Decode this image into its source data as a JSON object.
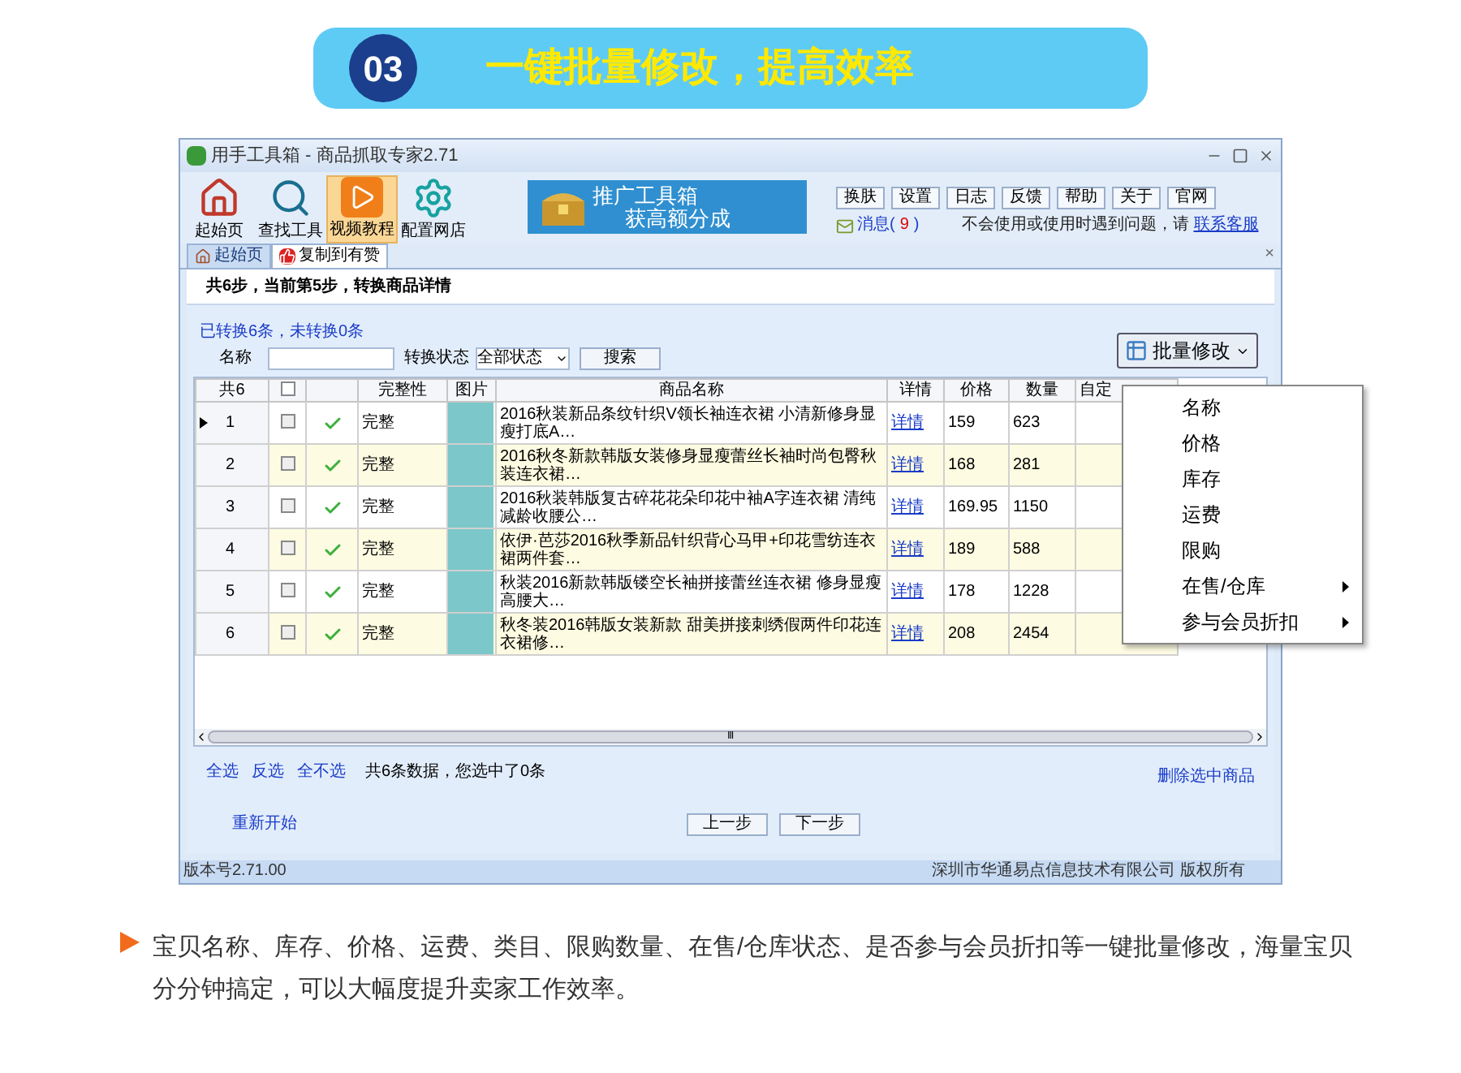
{
  "header": {
    "number": "03",
    "title": "一键批量修改，提高效率"
  },
  "window": {
    "title": "用手工具箱 - 商品抓取专家2.71",
    "toolbar": [
      {
        "label": "起始页",
        "kind": "home",
        "selected": false
      },
      {
        "label": "查找工具",
        "kind": "search",
        "selected": false
      },
      {
        "label": "视频教程",
        "kind": "video",
        "selected": true
      },
      {
        "label": "配置网店",
        "kind": "settings",
        "selected": false
      }
    ],
    "banner": {
      "line1": "推广工具箱",
      "line2": "获高额分成"
    },
    "buttons": [
      "换肤",
      "设置",
      "日志",
      "反馈",
      "帮助",
      "关于",
      "官网"
    ],
    "message": {
      "label": "消息(",
      "count": "9",
      "close": ")"
    },
    "help": {
      "text": "不会使用或使用时遇到问题，请",
      "link": "联系客服"
    },
    "tabs": [
      {
        "label": "起始页",
        "kind": "home",
        "selected": false
      },
      {
        "label": "复制到有赞",
        "kind": "thumb",
        "selected": true
      }
    ],
    "close_tab": "×",
    "step": "共6步，当前第5步，转换商品详情",
    "converted": "已转换6条，未转换0条",
    "filter": {
      "name_label": "名称",
      "status_label": "转换状态",
      "status_value": "全部状态",
      "search_button": "搜索"
    },
    "batch_button": "批量修改",
    "table": {
      "header_checked": false,
      "columns": [
        "共6",
        "",
        "",
        "完整性",
        "图片",
        "商品名称",
        "详情",
        "价格",
        "数量",
        "自定"
      ],
      "rows": [
        {
          "current": true,
          "checked": false,
          "index": "1",
          "completeness": "完整",
          "name": "2016秋装新品条纹针织V领长袖连衣裙 小清新修身显瘦打底A…",
          "detail": "详情",
          "price": "159",
          "qty": "623"
        },
        {
          "current": false,
          "checked": false,
          "index": "2",
          "completeness": "完整",
          "name": "2016秋冬新款韩版女装修身显瘦蕾丝长袖时尚包臀秋装连衣裙…",
          "detail": "详情",
          "price": "168",
          "qty": "281"
        },
        {
          "current": false,
          "checked": false,
          "index": "3",
          "completeness": "完整",
          "name": "2016秋装韩版复古碎花花朵印花中袖A字连衣裙 清纯减龄收腰公…",
          "detail": "详情",
          "price": "169.95",
          "qty": "1150"
        },
        {
          "current": false,
          "checked": false,
          "index": "4",
          "completeness": "完整",
          "name": "依伊·芭莎2016秋季新品针织背心马甲+印花雪纺连衣裙两件套…",
          "detail": "详情",
          "price": "189",
          "qty": "588"
        },
        {
          "current": false,
          "checked": false,
          "index": "5",
          "completeness": "完整",
          "name": "秋装2016新款韩版镂空长袖拼接蕾丝连衣裙 修身显瘦高腰大…",
          "detail": "详情",
          "price": "178",
          "qty": "1228"
        },
        {
          "current": false,
          "checked": false,
          "index": "6",
          "completeness": "完整",
          "name": "秋冬装2016韩版女装新款 甜美拼接刺绣假两件印花连衣裙修…",
          "detail": "详情",
          "price": "208",
          "qty": "2454"
        }
      ]
    },
    "menu": [
      {
        "label": "名称",
        "submenu": false
      },
      {
        "label": "价格",
        "submenu": false
      },
      {
        "label": "库存",
        "submenu": false
      },
      {
        "label": "运费",
        "submenu": false
      },
      {
        "label": "限购",
        "submenu": false
      },
      {
        "label": "在售/仓库",
        "submenu": true
      },
      {
        "label": "参与会员折扣",
        "submenu": true
      }
    ],
    "scroll_grip": "Ⅲ",
    "select_links": [
      "全选",
      "反选",
      "全不选"
    ],
    "selection_info": "共6条数据，您选中了0条",
    "delete_link": "删除选中商品",
    "restart_link": "重新开始",
    "nav_buttons": [
      "上一步",
      "下一步"
    ],
    "status_bar": {
      "version": "版本号2.71.00",
      "copyright": "深圳市华通易点信息技术有限公司 版权所有"
    }
  },
  "description": "宝贝名称、库存、价格、运费、类目、限购数量、在售/仓库状态、是否参与会员折扣等一键批量修改，海量宝贝分分钟搞定，可以大幅度提升卖家工作效率。"
}
